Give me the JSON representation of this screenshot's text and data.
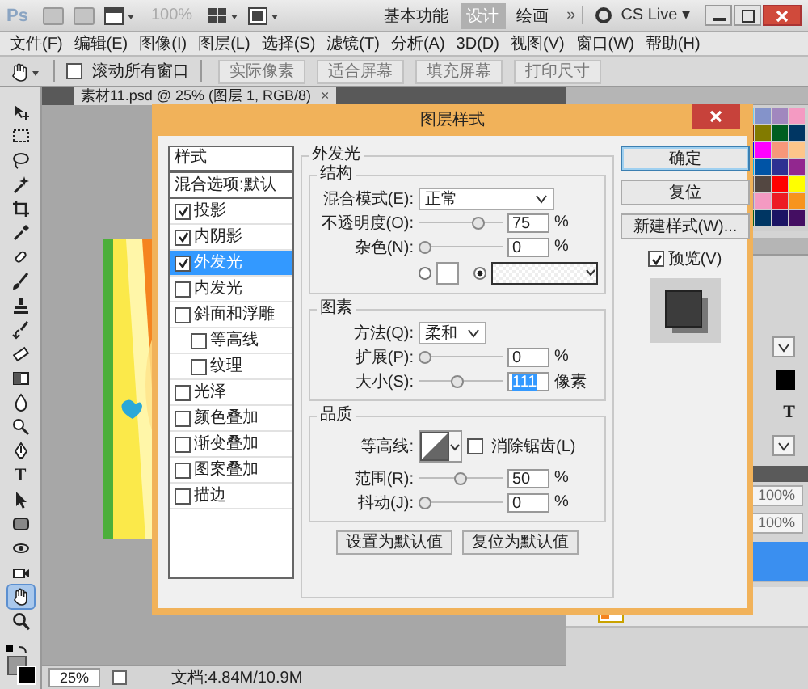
{
  "app_bar": {
    "logo": "Ps",
    "zoom": {
      "value": "100%",
      "disabled": true
    },
    "workspaces": [
      {
        "label": "基本功能",
        "selected": false
      },
      {
        "label": "设计",
        "selected": true
      },
      {
        "label": "绘画",
        "selected": false
      }
    ],
    "more": "»",
    "cs_live": "CS Live ▾"
  },
  "menu": [
    "文件(F)",
    "编辑(E)",
    "图像(I)",
    "图层(L)",
    "选择(S)",
    "滤镜(T)",
    "分析(A)",
    "3D(D)",
    "视图(V)",
    "窗口(W)",
    "帮助(H)"
  ],
  "options_bar": {
    "scroll_all": {
      "label": "滚动所有窗口",
      "checked": false
    },
    "buttons": [
      "实际像素",
      "适合屏幕",
      "填充屏幕",
      "打印尺寸"
    ]
  },
  "document_tab": {
    "title": "素材11.psd @ 25% (图层 1, RGB/8)",
    "close": "×"
  },
  "toolbox": {
    "tools": [
      {
        "kind": "move",
        "selected": false
      },
      {
        "kind": "marquee",
        "selected": false
      },
      {
        "kind": "lasso",
        "selected": false
      },
      {
        "kind": "wand",
        "selected": false
      },
      {
        "kind": "crop",
        "selected": false
      },
      {
        "kind": "eyedropper",
        "selected": false
      },
      {
        "kind": "healing",
        "selected": false
      },
      {
        "kind": "brush",
        "selected": false
      },
      {
        "kind": "stamp",
        "selected": false
      },
      {
        "kind": "history",
        "selected": false
      },
      {
        "kind": "eraser",
        "selected": false
      },
      {
        "kind": "gradient",
        "selected": false
      },
      {
        "kind": "blur",
        "selected": false
      },
      {
        "kind": "dodge",
        "selected": false
      },
      {
        "kind": "pen",
        "selected": false
      },
      {
        "kind": "type",
        "glyph": "T",
        "selected": false
      },
      {
        "kind": "path",
        "selected": false
      },
      {
        "kind": "shape",
        "selected": false
      },
      {
        "kind": "rotate3d",
        "selected": false
      },
      {
        "kind": "camera3d",
        "selected": false
      },
      {
        "kind": "hand",
        "selected": true
      },
      {
        "kind": "zoom",
        "selected": false
      }
    ]
  },
  "dialog": {
    "title": "图层样式",
    "styles_title": "样式",
    "styles": [
      {
        "kind": "blend",
        "label": "混合选项:默认",
        "selected": false
      },
      {
        "kind": "effect",
        "label": "投影",
        "checked": true,
        "selected": false
      },
      {
        "kind": "effect",
        "label": "内阴影",
        "checked": true,
        "selected": false
      },
      {
        "kind": "effect",
        "label": "外发光",
        "checked": true,
        "selected": true
      },
      {
        "kind": "effect",
        "label": "内发光",
        "checked": false,
        "selected": false
      },
      {
        "kind": "effect",
        "label": "斜面和浮雕",
        "checked": false,
        "selected": false,
        "children": [
          {
            "kind": "effect",
            "label": "等高线",
            "checked": false,
            "selected": false
          },
          {
            "kind": "effect",
            "label": "纹理",
            "checked": false,
            "selected": false
          }
        ]
      },
      {
        "kind": "effect",
        "label": "光泽",
        "checked": false,
        "selected": false
      },
      {
        "kind": "effect",
        "label": "颜色叠加",
        "checked": false,
        "selected": false
      },
      {
        "kind": "effect",
        "label": "渐变叠加",
        "checked": false,
        "selected": false
      },
      {
        "kind": "effect",
        "label": "图案叠加",
        "checked": false,
        "selected": false
      },
      {
        "kind": "effect",
        "label": "描边",
        "checked": false,
        "selected": false
      }
    ],
    "panel_title": "外发光",
    "groups": [
      {
        "title": "结构",
        "rows": [
          {
            "kind": "select",
            "label": "混合模式(E):",
            "value": "正常"
          },
          {
            "kind": "slider",
            "label": "不透明度(O):",
            "level": 0.75,
            "value": "75",
            "unit": "%",
            "highlighted": false
          },
          {
            "kind": "slider",
            "label": "杂色(N):",
            "level": 0,
            "value": "0",
            "unit": "%",
            "highlighted": false
          },
          {
            "kind": "fill",
            "options": [
              {
                "kind": "solid",
                "selected": false
              },
              {
                "kind": "gradient",
                "selected": true
              }
            ]
          }
        ]
      },
      {
        "title": "图素",
        "rows": [
          {
            "kind": "select",
            "label": "方法(Q):",
            "value": "柔和"
          },
          {
            "kind": "slider",
            "label": "扩展(P):",
            "level": 0,
            "value": "0",
            "unit": "%",
            "highlighted": false
          },
          {
            "kind": "slider",
            "label": "大小(S):",
            "level": 0.45,
            "value": "111",
            "unit": "像素",
            "highlighted": true
          }
        ]
      },
      {
        "title": "品质",
        "rows": [
          {
            "kind": "contour",
            "label": "等高线:",
            "checkbox": {
              "label": "消除锯齿(L)",
              "checked": false
            }
          },
          {
            "kind": "slider",
            "label": "范围(R):",
            "level": 0.5,
            "value": "50",
            "unit": "%",
            "highlighted": false
          },
          {
            "kind": "slider",
            "label": "抖动(J):",
            "level": 0,
            "value": "0",
            "unit": "%",
            "highlighted": false
          }
        ]
      }
    ],
    "default_buttons": [
      "设置为默认值",
      "复位为默认值"
    ],
    "actions": [
      {
        "kind": "default",
        "label": "确定"
      },
      {
        "kind": "normal",
        "label": "复位"
      },
      {
        "kind": "normal",
        "label": "新建样式(W)..."
      }
    ],
    "preview": {
      "label": "预览(V)",
      "checked": true
    }
  },
  "dock": {
    "type_glyph": "T",
    "opacity": "100%",
    "fill": "100%",
    "layers": [
      {
        "selected": true
      },
      {
        "selected": false
      }
    ]
  },
  "status_bar": {
    "zoom": "25%",
    "doc_size": "文档:4.84M/10.9M"
  }
}
